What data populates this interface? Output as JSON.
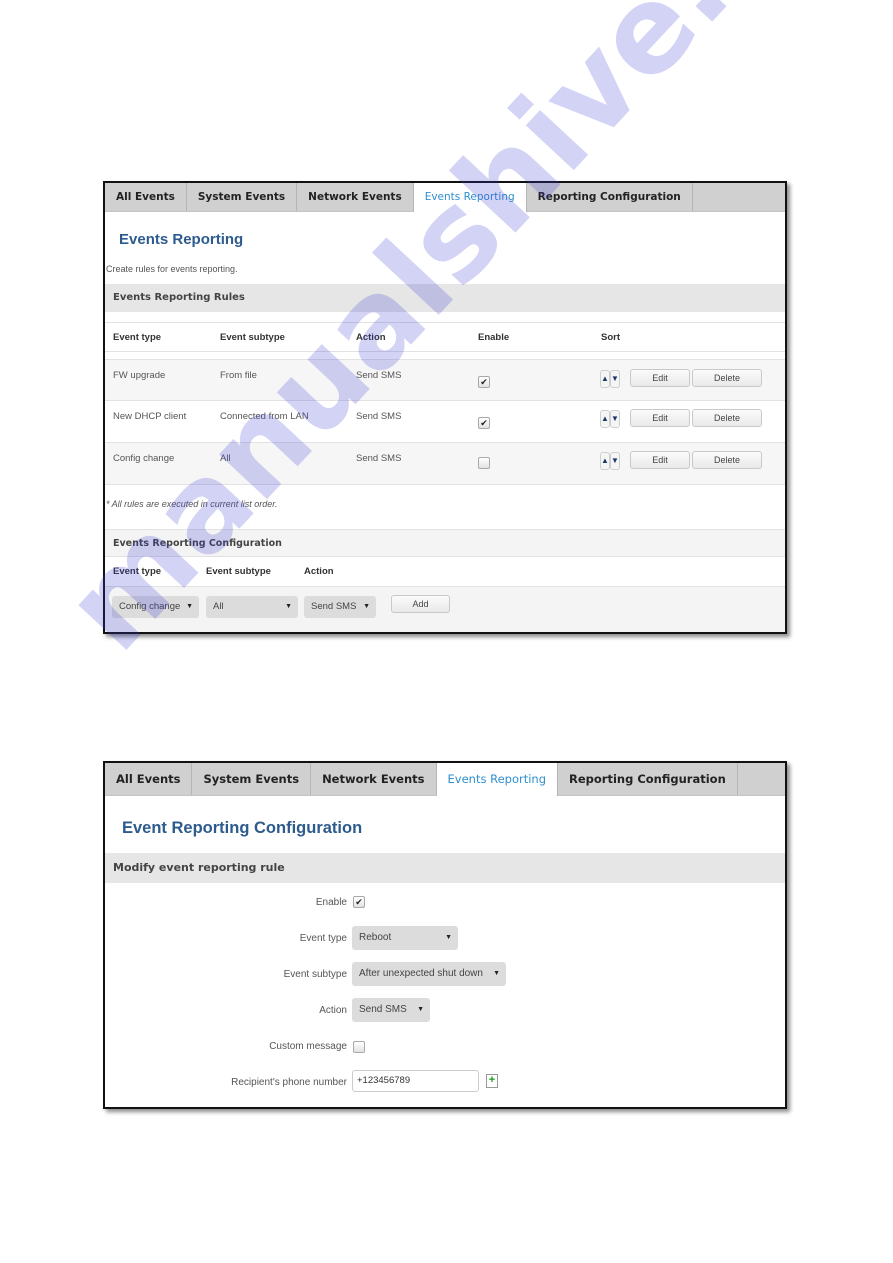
{
  "tabs": [
    {
      "label": "All Events",
      "active": false
    },
    {
      "label": "System Events",
      "active": false
    },
    {
      "label": "Network Events",
      "active": false
    },
    {
      "label": "Events Reporting",
      "active": true
    },
    {
      "label": "Reporting Configuration",
      "active": false
    }
  ],
  "rules_page": {
    "title": "Events Reporting",
    "description": "Create rules for events reporting.",
    "rules_section": "Events Reporting Rules",
    "columns": [
      "Event type",
      "Event subtype",
      "Action",
      "Enable",
      "Sort"
    ],
    "rows": [
      {
        "event_type": "FW upgrade",
        "event_subtype": "From file",
        "action": "Send SMS",
        "enabled": true
      },
      {
        "event_type": "New DHCP client",
        "event_subtype": "Connected from LAN",
        "action": "Send SMS",
        "enabled": true
      },
      {
        "event_type": "Config change",
        "event_subtype": "All",
        "action": "Send SMS",
        "enabled": false
      }
    ],
    "sort_up_icon": "arrow-up-icon",
    "sort_down_icon": "arrow-down-icon",
    "edit_label": "Edit",
    "delete_label": "Delete",
    "note": "* All rules are executed in current list order.",
    "config_section": "Events Reporting Configuration",
    "config_columns": [
      "Event type",
      "Event subtype",
      "Action"
    ],
    "new_rule": {
      "event_type": "Config change",
      "event_subtype": "All",
      "action": "Send SMS"
    },
    "add_label": "Add"
  },
  "config_page": {
    "title": "Event Reporting Configuration",
    "section": "Modify event reporting rule",
    "fields": {
      "enable": {
        "label": "Enable",
        "checked": true
      },
      "event_type": {
        "label": "Event type",
        "value": "Reboot"
      },
      "event_subtype": {
        "label": "Event subtype",
        "value": "After unexpected shut down"
      },
      "action": {
        "label": "Action",
        "value": "Send SMS"
      },
      "custom_message": {
        "label": "Custom message",
        "checked": false
      },
      "phone": {
        "label": "Recipient's phone number",
        "value": "+123456789",
        "add_icon": "add-document-icon"
      }
    }
  },
  "glyphs": {
    "check": "✔",
    "up": "▲",
    "down": "▼",
    "dropdown": "▼",
    "plus": "+"
  },
  "watermark": "manualshive.com",
  "colors": {
    "title_blue": "#2d5b8e",
    "active_tab": "#2f8fcf",
    "tab_bg": "#d0d0d0",
    "section_bg": "#e6e6e6",
    "watermark": "#3a3ad8"
  }
}
